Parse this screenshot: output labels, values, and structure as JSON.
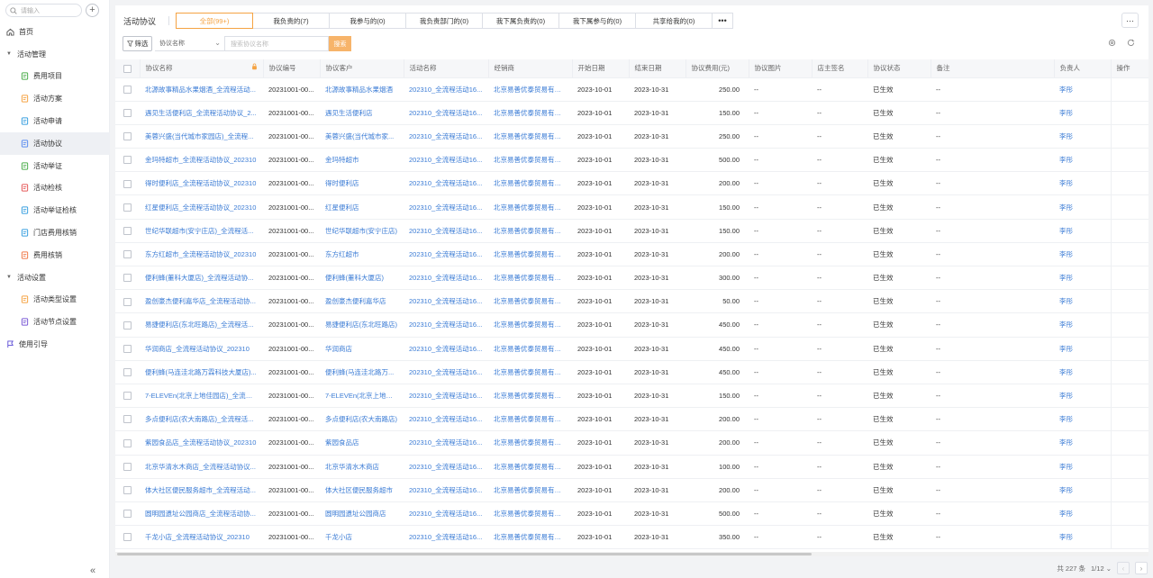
{
  "sidebar": {
    "search_placeholder": "请输入",
    "add_label": "+",
    "items": [
      {
        "label": "首页",
        "type": "top",
        "icon": "home-icon"
      },
      {
        "label": "活动管理",
        "type": "group",
        "icon": "caret-down-icon"
      },
      {
        "label": "费用项目",
        "type": "child",
        "icon": "coin-icon",
        "color": "#4cae4c"
      },
      {
        "label": "活动方案",
        "type": "child",
        "icon": "plan-icon",
        "color": "#f5a343"
      },
      {
        "label": "活动申请",
        "type": "child",
        "icon": "apply-icon",
        "color": "#3aa0e0"
      },
      {
        "label": "活动协议",
        "type": "child",
        "icon": "agreement-icon",
        "color": "#5b8def",
        "active": true
      },
      {
        "label": "活动举证",
        "type": "child",
        "icon": "evidence-icon",
        "color": "#4cae4c"
      },
      {
        "label": "活动检核",
        "type": "child",
        "icon": "check-icon",
        "color": "#e55a5a"
      },
      {
        "label": "活动举证检核",
        "type": "child",
        "icon": "evidence-check-icon",
        "color": "#3aa0e0"
      },
      {
        "label": "门店费用核销",
        "type": "child",
        "icon": "store-icon",
        "color": "#3aa0e0"
      },
      {
        "label": "费用核销",
        "type": "child",
        "icon": "writeoff-icon",
        "color": "#f07a4a"
      },
      {
        "label": "活动设置",
        "type": "group",
        "icon": "caret-down-icon"
      },
      {
        "label": "活动类型设置",
        "type": "child",
        "icon": "type-setting-icon",
        "color": "#f5a343"
      },
      {
        "label": "活动节点设置",
        "type": "child",
        "icon": "node-setting-icon",
        "color": "#7b5bd6"
      },
      {
        "label": "使用引导",
        "type": "top",
        "icon": "flag-icon"
      }
    ],
    "collapse_label": "«"
  },
  "header": {
    "title": "活动协议",
    "tabs": [
      "全部(99+)",
      "我负责的(7)",
      "我参与的(0)",
      "我负责部门的(0)",
      "我下属负责的(0)",
      "我下属参与的(0)",
      "共享给我的(0)"
    ],
    "tab_more": "•••",
    "more_btn": "···"
  },
  "filter": {
    "filter_label": "筛选",
    "field": "协议名称",
    "search_placeholder": "搜索协议名称",
    "search_button": "搜索"
  },
  "table": {
    "columns": [
      "协议名称",
      "协议编号",
      "协议客户",
      "活动名称",
      "经销商",
      "开始日期",
      "结束日期",
      "协议费用(元)",
      "协议图片",
      "店主签名",
      "协议状态",
      "备注",
      "负责人",
      "操作"
    ],
    "rows": [
      [
        "北源故事精品水果烟酒_全流程活动...",
        "20231001-00...",
        "北源故事精品水果烟酒",
        "202310_全流程活动16...",
        "北京易善优泰贸易有限...",
        "2023-10-01",
        "2023-10-31",
        "250.00",
        "--",
        "--",
        "已生效",
        "--",
        "李彤"
      ],
      [
        "遇见生活便利店_全流程活动协议_2...",
        "20231001-00...",
        "遇见生活便利店",
        "202310_全流程活动16...",
        "北京易善优泰贸易有限...",
        "2023-10-01",
        "2023-10-31",
        "150.00",
        "--",
        "--",
        "已生效",
        "--",
        "李彤"
      ],
      [
        "美蓉兴盛(当代城市家园店)_全流程...",
        "20231001-00...",
        "美蓉兴盛(当代城市家...",
        "202310_全流程活动16...",
        "北京易善优泰贸易有限...",
        "2023-10-01",
        "2023-10-31",
        "250.00",
        "--",
        "--",
        "已生效",
        "--",
        "李彤"
      ],
      [
        "金玛特超市_全流程活动协议_202310",
        "20231001-00...",
        "金玛特超市",
        "202310_全流程活动16...",
        "北京易善优泰贸易有限...",
        "2023-10-01",
        "2023-10-31",
        "500.00",
        "--",
        "--",
        "已生效",
        "--",
        "李彤"
      ],
      [
        "得时便利店_全流程活动协议_202310",
        "20231001-00...",
        "得时便利店",
        "202310_全流程活动16...",
        "北京易善优泰贸易有限...",
        "2023-10-01",
        "2023-10-31",
        "200.00",
        "--",
        "--",
        "已生效",
        "--",
        "李彤"
      ],
      [
        "红星便利店_全流程活动协议_202310",
        "20231001-00...",
        "红星便利店",
        "202310_全流程活动16...",
        "北京易善优泰贸易有限...",
        "2023-10-01",
        "2023-10-31",
        "150.00",
        "--",
        "--",
        "已生效",
        "--",
        "李彤"
      ],
      [
        "世纪华联超市(安宁庄店)_全流程活...",
        "20231001-00...",
        "世纪华联超市(安宁庄店)",
        "202310_全流程活动16...",
        "北京易善优泰贸易有限...",
        "2023-10-01",
        "2023-10-31",
        "150.00",
        "--",
        "--",
        "已生效",
        "--",
        "李彤"
      ],
      [
        "东方红超市_全流程活动协议_202310",
        "20231001-00...",
        "东方红超市",
        "202310_全流程活动16...",
        "北京易善优泰贸易有限...",
        "2023-10-01",
        "2023-10-31",
        "200.00",
        "--",
        "--",
        "已生效",
        "--",
        "李彤"
      ],
      [
        "便利蜂(董科大厦店)_全流程活动协...",
        "20231001-00...",
        "便利蜂(董科大厦店)",
        "202310_全流程活动16...",
        "北京易善优泰贸易有限...",
        "2023-10-01",
        "2023-10-31",
        "300.00",
        "--",
        "--",
        "已生效",
        "--",
        "李彤"
      ],
      [
        "盈创豪杰便利嘉华店_全流程活动协...",
        "20231001-00...",
        "盈创豪杰便利嘉华店",
        "202310_全流程活动16...",
        "北京易善优泰贸易有限...",
        "2023-10-01",
        "2023-10-31",
        "50.00",
        "--",
        "--",
        "已生效",
        "--",
        "李彤"
      ],
      [
        "易捷便利店(东北旺路店)_全流程活...",
        "20231001-00...",
        "易捷便利店(东北旺路店)",
        "202310_全流程活动16...",
        "北京易善优泰贸易有限...",
        "2023-10-01",
        "2023-10-31",
        "450.00",
        "--",
        "--",
        "已生效",
        "--",
        "李彤"
      ],
      [
        "华润商店_全流程活动协议_202310",
        "20231001-00...",
        "华润商店",
        "202310_全流程活动16...",
        "北京易善优泰贸易有限...",
        "2023-10-01",
        "2023-10-31",
        "450.00",
        "--",
        "--",
        "已生效",
        "--",
        "李彤"
      ],
      [
        "便利蜂(马连洼北路万霖科技大厦店)...",
        "20231001-00...",
        "便利蜂(马连洼北路万...",
        "202310_全流程活动16...",
        "北京易善优泰贸易有限...",
        "2023-10-01",
        "2023-10-31",
        "450.00",
        "--",
        "--",
        "已生效",
        "--",
        "李彤"
      ],
      [
        "7-ELEVEn(北京上地佳园店)_全流程...",
        "20231001-00...",
        "7-ELEVEn(北京上地佳...",
        "202310_全流程活动16...",
        "北京易善优泰贸易有限...",
        "2023-10-01",
        "2023-10-31",
        "150.00",
        "--",
        "--",
        "已生效",
        "--",
        "李彤"
      ],
      [
        "多点便利店(农大南路店)_全流程活...",
        "20231001-00...",
        "多点便利店(农大南路店)",
        "202310_全流程活动16...",
        "北京易善优泰贸易有限...",
        "2023-10-01",
        "2023-10-31",
        "200.00",
        "--",
        "--",
        "已生效",
        "--",
        "李彤"
      ],
      [
        "紫园食品店_全流程活动协议_202310",
        "20231001-00...",
        "紫园食品店",
        "202310_全流程活动16...",
        "北京易善优泰贸易有限...",
        "2023-10-01",
        "2023-10-31",
        "200.00",
        "--",
        "--",
        "已生效",
        "--",
        "李彤"
      ],
      [
        "北京华清水木商店_全流程活动协议...",
        "20231001-00...",
        "北京华清水木商店",
        "202310_全流程活动16...",
        "北京易善优泰贸易有限...",
        "2023-10-01",
        "2023-10-31",
        "100.00",
        "--",
        "--",
        "已生效",
        "--",
        "李彤"
      ],
      [
        "体大社区便民服务超市_全流程活动...",
        "20231001-00...",
        "体大社区便民服务超市",
        "202310_全流程活动16...",
        "北京易善优泰贸易有限...",
        "2023-10-01",
        "2023-10-31",
        "200.00",
        "--",
        "--",
        "已生效",
        "--",
        "李彤"
      ],
      [
        "圆明园遗址公园商店_全流程活动协...",
        "20231001-00...",
        "圆明园遗址公园商店",
        "202310_全流程活动16...",
        "北京易善优泰贸易有限...",
        "2023-10-01",
        "2023-10-31",
        "500.00",
        "--",
        "--",
        "已生效",
        "--",
        "李彤"
      ],
      [
        "千龙小店_全流程活动协议_202310",
        "20231001-00...",
        "千龙小店",
        "202310_全流程活动16...",
        "北京易善优泰贸易有限...",
        "2023-10-01",
        "2023-10-31",
        "350.00",
        "--",
        "--",
        "已生效",
        "--",
        "李彤"
      ]
    ]
  },
  "pagination": {
    "total": "共 227 条",
    "page": "1/12",
    "prev": "‹",
    "next": "›"
  },
  "colors": {
    "accent": "#f5a343",
    "link": "#3a7bd5"
  }
}
